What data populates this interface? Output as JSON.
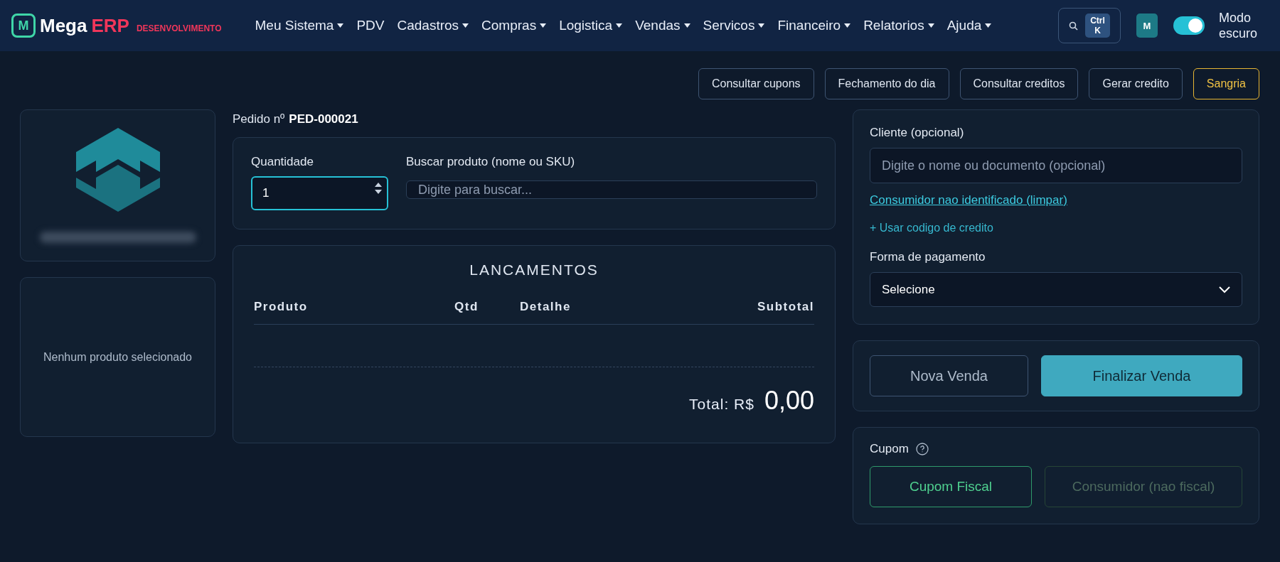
{
  "header": {
    "logo_letter": "M",
    "brand": "Mega",
    "brand_accent": "ERP",
    "environment": "DESENVOLVIMENTO",
    "nav": [
      {
        "label": "Meu Sistema",
        "has_menu": true
      },
      {
        "label": "PDV",
        "has_menu": false
      },
      {
        "label": "Cadastros",
        "has_menu": true
      },
      {
        "label": "Compras",
        "has_menu": true
      },
      {
        "label": "Logistica",
        "has_menu": true
      },
      {
        "label": "Vendas",
        "has_menu": true
      },
      {
        "label": "Servicos",
        "has_menu": true
      },
      {
        "label": "Financeiro",
        "has_menu": true
      },
      {
        "label": "Relatorios",
        "has_menu": true
      },
      {
        "label": "Ajuda",
        "has_menu": true
      }
    ],
    "shortcut_keys": [
      "Ctrl",
      "K"
    ],
    "avatar": "M",
    "dark_mode": {
      "label": "Modo escuro",
      "on": true
    }
  },
  "actions": [
    {
      "label": "Consultar cupons",
      "kind": "default"
    },
    {
      "label": "Fechamento do dia",
      "kind": "default"
    },
    {
      "label": "Consultar creditos",
      "kind": "default"
    },
    {
      "label": "Gerar credito",
      "kind": "default"
    },
    {
      "label": "Sangria",
      "kind": "warning"
    }
  ],
  "product_panel": {
    "empty_text": "Nenhum produto selecionado"
  },
  "order": {
    "label": "Pedido nº",
    "number": "PED-000021"
  },
  "entry": {
    "quantity_label": "Quantidade",
    "quantity": "1",
    "search_label": "Buscar produto (nome ou SKU)",
    "search_placeholder": "Digite para buscar..."
  },
  "lancamentos": {
    "title": "LANCAMENTOS",
    "columns": [
      "Produto",
      "Qtd",
      "Detalhe",
      "Subtotal"
    ],
    "total_label": "Total: R$",
    "total": "0,00"
  },
  "client": {
    "label": "Cliente (opcional)",
    "placeholder": "Digite o nome ou documento (opcional)",
    "clear_link": "Consumidor nao identificado (limpar)",
    "credit_link": "+ Usar codigo de credito",
    "payment_label": "Forma de pagamento",
    "payment_value": "Selecione"
  },
  "sale_buttons": [
    {
      "label": "Nova Venda",
      "kind": "secondary"
    },
    {
      "label": "Finalizar Venda",
      "kind": "primary"
    }
  ],
  "coupon": {
    "label": "Cupom",
    "options": [
      {
        "label": "Cupom Fiscal",
        "selected": true
      },
      {
        "label": "Consumidor (nao fiscal)",
        "selected": false
      }
    ]
  }
}
